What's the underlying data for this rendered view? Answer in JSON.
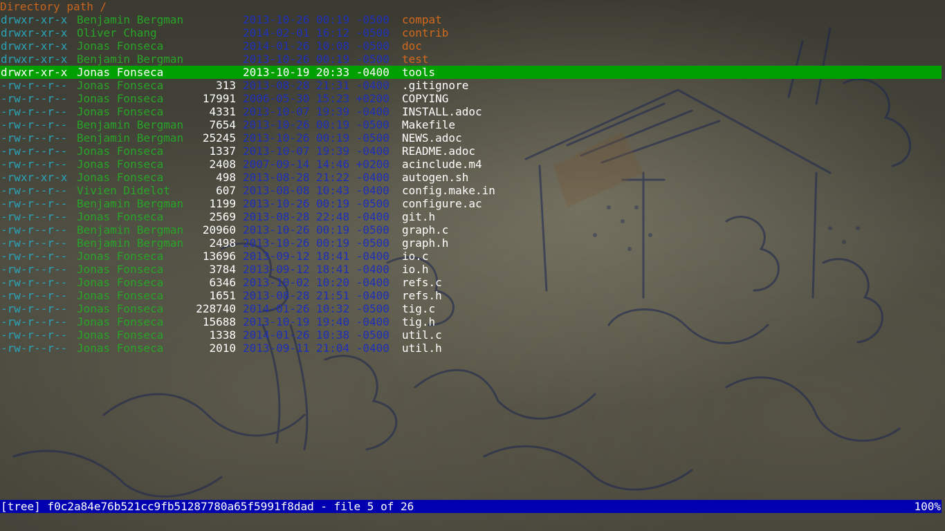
{
  "title": "Directory path /",
  "rows": [
    {
      "mode": "drwxr-xr-x",
      "author": "Benjamin Bergman",
      "size": "",
      "date": "2013-10-26 00:19 -0500",
      "name": "compat",
      "is_dir": true
    },
    {
      "mode": "drwxr-xr-x",
      "author": "Oliver Chang",
      "size": "",
      "date": "2014-02-01 16:12 -0500",
      "name": "contrib",
      "is_dir": true
    },
    {
      "mode": "drwxr-xr-x",
      "author": "Jonas Fonseca",
      "size": "",
      "date": "2014-01-26 10:08 -0500",
      "name": "doc",
      "is_dir": true
    },
    {
      "mode": "drwxr-xr-x",
      "author": "Benjamin Bergman",
      "size": "",
      "date": "2013-10-26 00:19 -0500",
      "name": "test",
      "is_dir": true
    },
    {
      "mode": "drwxr-xr-x",
      "author": "Jonas Fonseca",
      "size": "",
      "date": "2013-10-19 20:33 -0400",
      "name": "tools",
      "is_dir": true,
      "selected": true
    },
    {
      "mode": "-rw-r--r--",
      "author": "Jonas Fonseca",
      "size": "313",
      "date": "2013-08-28 21:31 -0400",
      "name": ".gitignore"
    },
    {
      "mode": "-rw-r--r--",
      "author": "Jonas Fonseca",
      "size": "17991",
      "date": "2006-05-30 15:23 +0200",
      "name": "COPYING"
    },
    {
      "mode": "-rw-r--r--",
      "author": "Jonas Fonseca",
      "size": "4331",
      "date": "2013-10-07 19:39 -0400",
      "name": "INSTALL.adoc"
    },
    {
      "mode": "-rw-r--r--",
      "author": "Benjamin Bergman",
      "size": "7654",
      "date": "2013-10-26 00:19 -0500",
      "name": "Makefile"
    },
    {
      "mode": "-rw-r--r--",
      "author": "Benjamin Bergman",
      "size": "25245",
      "date": "2013-10-26 00:19 -0500",
      "name": "NEWS.adoc"
    },
    {
      "mode": "-rw-r--r--",
      "author": "Jonas Fonseca",
      "size": "1337",
      "date": "2013-10-07 19:39 -0400",
      "name": "README.adoc"
    },
    {
      "mode": "-rw-r--r--",
      "author": "Jonas Fonseca",
      "size": "2408",
      "date": "2007-09-14 14:46 +0200",
      "name": "acinclude.m4"
    },
    {
      "mode": "-rwxr-xr-x",
      "author": "Jonas Fonseca",
      "size": "498",
      "date": "2013-08-28 21:22 -0400",
      "name": "autogen.sh"
    },
    {
      "mode": "-rw-r--r--",
      "author": "Vivien Didelot",
      "size": "607",
      "date": "2013-08-08 10:43 -0400",
      "name": "config.make.in"
    },
    {
      "mode": "-rw-r--r--",
      "author": "Benjamin Bergman",
      "size": "1199",
      "date": "2013-10-26 00:19 -0500",
      "name": "configure.ac"
    },
    {
      "mode": "-rw-r--r--",
      "author": "Jonas Fonseca",
      "size": "2569",
      "date": "2013-08-28 22:48 -0400",
      "name": "git.h"
    },
    {
      "mode": "-rw-r--r--",
      "author": "Benjamin Bergman",
      "size": "20960",
      "date": "2013-10-26 00:19 -0500",
      "name": "graph.c"
    },
    {
      "mode": "-rw-r--r--",
      "author": "Benjamin Bergman",
      "size": "2498",
      "date": "2013-10-26 00:19 -0500",
      "name": "graph.h"
    },
    {
      "mode": "-rw-r--r--",
      "author": "Jonas Fonseca",
      "size": "13696",
      "date": "2013-09-12 18:41 -0400",
      "name": "io.c"
    },
    {
      "mode": "-rw-r--r--",
      "author": "Jonas Fonseca",
      "size": "3784",
      "date": "2013-09-12 18:41 -0400",
      "name": "io.h"
    },
    {
      "mode": "-rw-r--r--",
      "author": "Jonas Fonseca",
      "size": "6346",
      "date": "2013-10-02 10:20 -0400",
      "name": "refs.c"
    },
    {
      "mode": "-rw-r--r--",
      "author": "Jonas Fonseca",
      "size": "1651",
      "date": "2013-08-28 21:51 -0400",
      "name": "refs.h"
    },
    {
      "mode": "-rw-r--r--",
      "author": "Jonas Fonseca",
      "size": "228740",
      "date": "2014-01-26 10:32 -0500",
      "name": "tig.c"
    },
    {
      "mode": "-rw-r--r--",
      "author": "Jonas Fonseca",
      "size": "15688",
      "date": "2013-10-19 19:40 -0400",
      "name": "tig.h"
    },
    {
      "mode": "-rw-r--r--",
      "author": "Jonas Fonseca",
      "size": "1338",
      "date": "2014-01-26 10:38 -0500",
      "name": "util.c"
    },
    {
      "mode": "-rw-r--r--",
      "author": "Jonas Fonseca",
      "size": "2010",
      "date": "2013-09-11 21:04 -0400",
      "name": "util.h"
    }
  ],
  "status": {
    "left": "[tree] f0c2a84e76b521cc9fb51287780a65f5991f8dad - file 5 of 26",
    "right": "100%"
  },
  "colors": {
    "title": "#c8641e",
    "mode": "#2aa3b8",
    "author": "#28a428",
    "date": "#1e2fb8",
    "dir_name": "#d2691e",
    "selection": "#00a000",
    "status_bar": "#0000b0"
  }
}
